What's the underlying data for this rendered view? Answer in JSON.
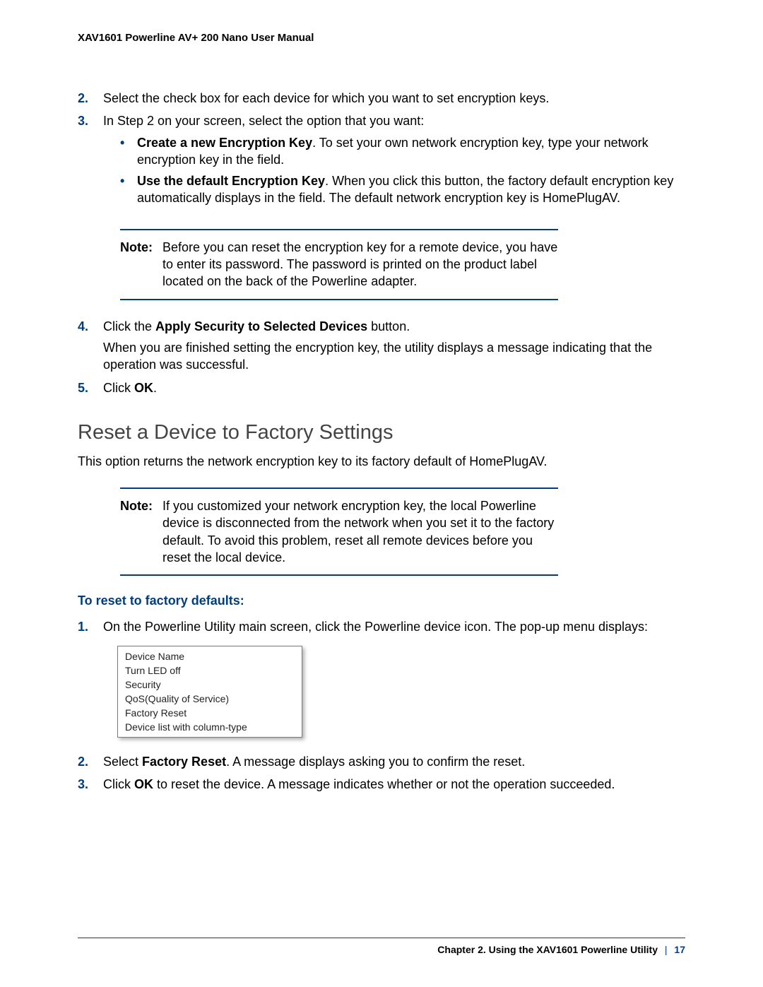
{
  "header": "XAV1601 Powerline AV+ 200 Nano User Manual",
  "steps_a": {
    "s2": {
      "num": "2.",
      "text": "Select the check box for each device for which you want to set encryption keys."
    },
    "s3": {
      "num": "3.",
      "text": "In Step 2 on your screen, select the option that you want:"
    },
    "s3_b1_bold": "Create a new Encryption Key",
    "s3_b1_rest": ". To set your own network encryption key, type your network encryption key in the field.",
    "s3_b2_bold": "Use the default Encryption Key",
    "s3_b2_rest": ". When you click this button, the factory default encryption key automatically displays in the field. The default network encryption key is HomePlugAV.",
    "s4": {
      "num": "4.",
      "pre": "Click the ",
      "bold": "Apply Security to Selected Devices",
      "post": " button."
    },
    "s4_para": "When you are finished setting the encryption key, the utility displays a message indicating that the operation was successful.",
    "s5": {
      "num": "5.",
      "pre": "Click ",
      "bold": "OK",
      "post": "."
    }
  },
  "note1": {
    "label": "Note:",
    "text": "Before you can reset the encryption key for a remote device, you have to enter its password. The password is printed on the product label located on the back of the Powerline adapter."
  },
  "section_title": "Reset a Device to Factory Settings",
  "section_intro": "This option returns the network encryption key to its factory default of HomePlugAV.",
  "note2": {
    "label": "Note:",
    "text": "If you customized your network encryption key, the local Powerline device is disconnected from the network when you set it to the factory default. To avoid this problem, reset all remote devices before you reset the local device."
  },
  "subhead": "To reset to factory defaults:",
  "steps_b": {
    "s1": {
      "num": "1.",
      "text": "On the Powerline Utility main screen, click the Powerline device icon. The pop-up menu displays:"
    },
    "s2": {
      "num": "2.",
      "pre": "Select ",
      "bold": "Factory Reset",
      "post": ". A message displays asking you to confirm the reset."
    },
    "s3": {
      "num": "3.",
      "pre": "Click ",
      "bold": "OK",
      "post": " to reset the device. A message indicates whether or not the operation succeeded."
    }
  },
  "menu": {
    "i0": "Device Name",
    "i1": "Turn LED off",
    "i2": "Security",
    "i3": "QoS(Quality of Service)",
    "i4": "Factory Reset",
    "i5": "Device list with column-type"
  },
  "footer": {
    "chapter": "Chapter 2.  Using the XAV1601 Powerline Utility",
    "sep": "|",
    "page": "17"
  }
}
